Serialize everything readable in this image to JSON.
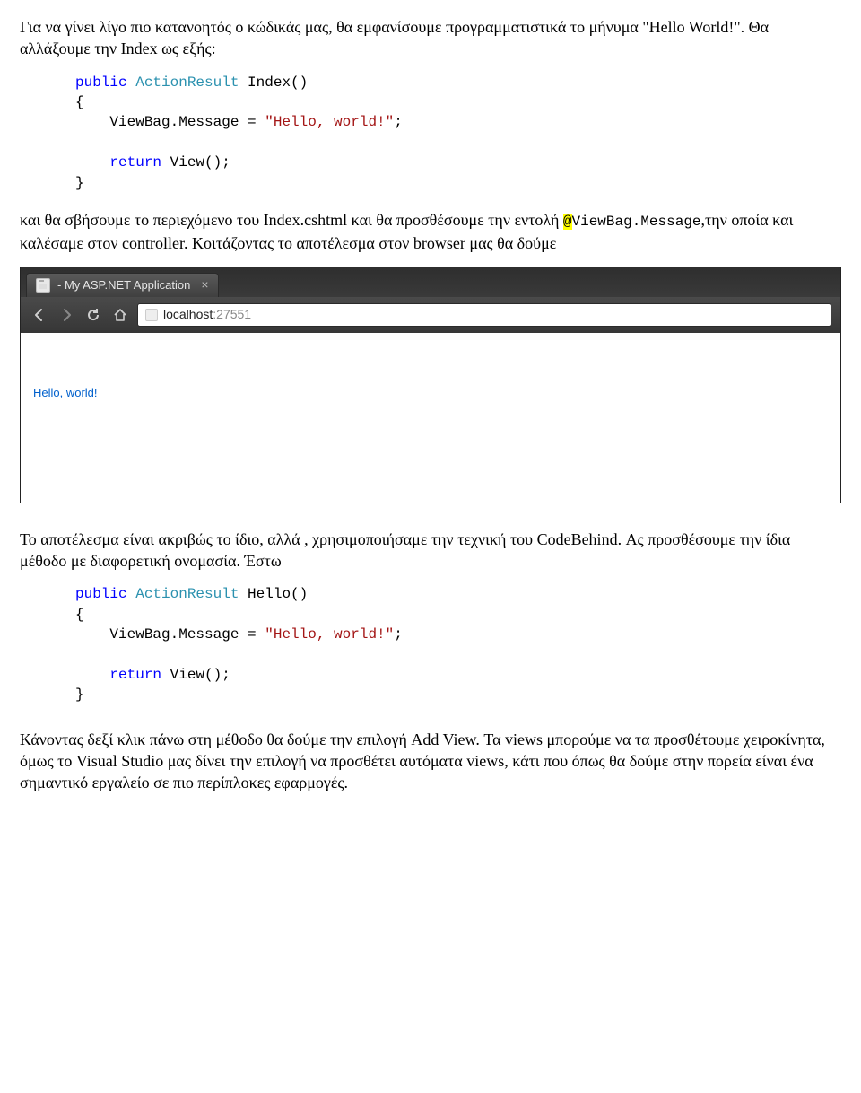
{
  "para1": "Για να γίνει λίγο πιο κατανοητός ο κώδικάς μας, θα εμφανίσουμε προγραμματιστικά το μήνυμα \"Hello World!\". Θα αλλάξουμε την Index ως εξής:",
  "code1": {
    "kw_public": "public",
    "type_actionresult": "ActionResult",
    "fn_index": " Index()",
    "brace_open": "{",
    "line_viewbag": "    ViewBag.Message = ",
    "str_hello": "\"Hello, world!\"",
    "semi": ";",
    "kw_return": "return",
    "call_view": " View();",
    "brace_close": "}"
  },
  "para2_a": "και θα σβήσουμε το περιεχόμενο του Index.cshtml και θα προσθέσουμε την εντολή ",
  "para2_code": "@ViewBag.Message",
  "para2_b": ",την οποία και καλέσαμε στον controller. Κοιτάζοντας το αποτέλεσμα στον browser μας θα δούμε",
  "browser": {
    "tab_title": "- My ASP.NET Application",
    "tab_close": "×",
    "url_host": "localhost",
    "url_rest": ":27551",
    "page_text": "Hello, world!"
  },
  "para3": "Το αποτέλεσμα είναι ακριβώς το ίδιο, αλλά , χρησιμοποιήσαμε την τεχνική του CodeBehind. Ας προσθέσουμε την ίδια μέθοδο με διαφορετική ονομασία. Έστω",
  "code2": {
    "kw_public": "public",
    "type_actionresult": "ActionResult",
    "fn_hello": " Hello()",
    "brace_open": "{",
    "line_viewbag": "    ViewBag.Message = ",
    "str_hello": "\"Hello, world!\"",
    "semi": ";",
    "kw_return": "return",
    "call_view": " View();",
    "brace_close": "}"
  },
  "para4": "Κάνοντας δεξί κλικ πάνω στη μέθοδο θα δούμε την επιλογή Add View. Τα views μπορούμε να τα προσθέτουμε χειροκίνητα, όμως το Visual Studio μας δίνει την επιλογή να προσθέτει αυτόματα views, κάτι που όπως θα δούμε στην πορεία είναι ένα σημαντικό εργαλείο σε πιο περίπλοκες εφαρμογές."
}
